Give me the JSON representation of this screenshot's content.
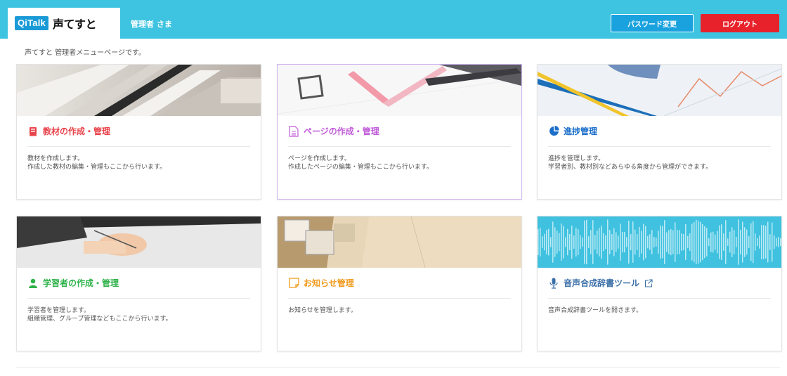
{
  "header": {
    "logo_badge": "QiTalk",
    "logo_text": "声てすと",
    "admin_name": "管理者 さま",
    "password_button": "パスワード変更",
    "logout_button": "ログアウト"
  },
  "page_description": "声てすと 管理者メニューページです。",
  "cards": [
    {
      "title": "教材の作成・管理",
      "desc1": "教材を作成します。",
      "desc2": "作成した教材の編集・管理もここから行います。",
      "color": "#e8424a",
      "icon": "book-icon"
    },
    {
      "title": "ページの作成・管理",
      "desc1": "ページを作成します。",
      "desc2": "作成したページの編集・管理もここから行います。",
      "color": "#c05bd8",
      "icon": "page-icon"
    },
    {
      "title": "進捗管理",
      "desc1": "進捗を管理します。",
      "desc2": "学習者別、教材別などあらゆる角度から管理ができます。",
      "color": "#1a6ec9",
      "icon": "pie-chart-icon"
    },
    {
      "title": "学習者の作成・管理",
      "desc1": "学習者を管理します。",
      "desc2": "組織管理、グループ管理などもここから行います。",
      "color": "#2fb24a",
      "icon": "user-icon"
    },
    {
      "title": "お知らせ管理",
      "desc1": "お知らせを管理します。",
      "desc2": "",
      "color": "#f09a1c",
      "icon": "note-icon"
    },
    {
      "title": "音声合成辞書ツール",
      "desc1": "音声合成辞書ツールを開きます。",
      "desc2": "",
      "color": "#3a6fa8",
      "icon": "microphone-icon"
    }
  ],
  "colors": {
    "header": "#3ec3e0",
    "password_btn": "#1aa2de",
    "logout_btn": "#e8222a"
  }
}
